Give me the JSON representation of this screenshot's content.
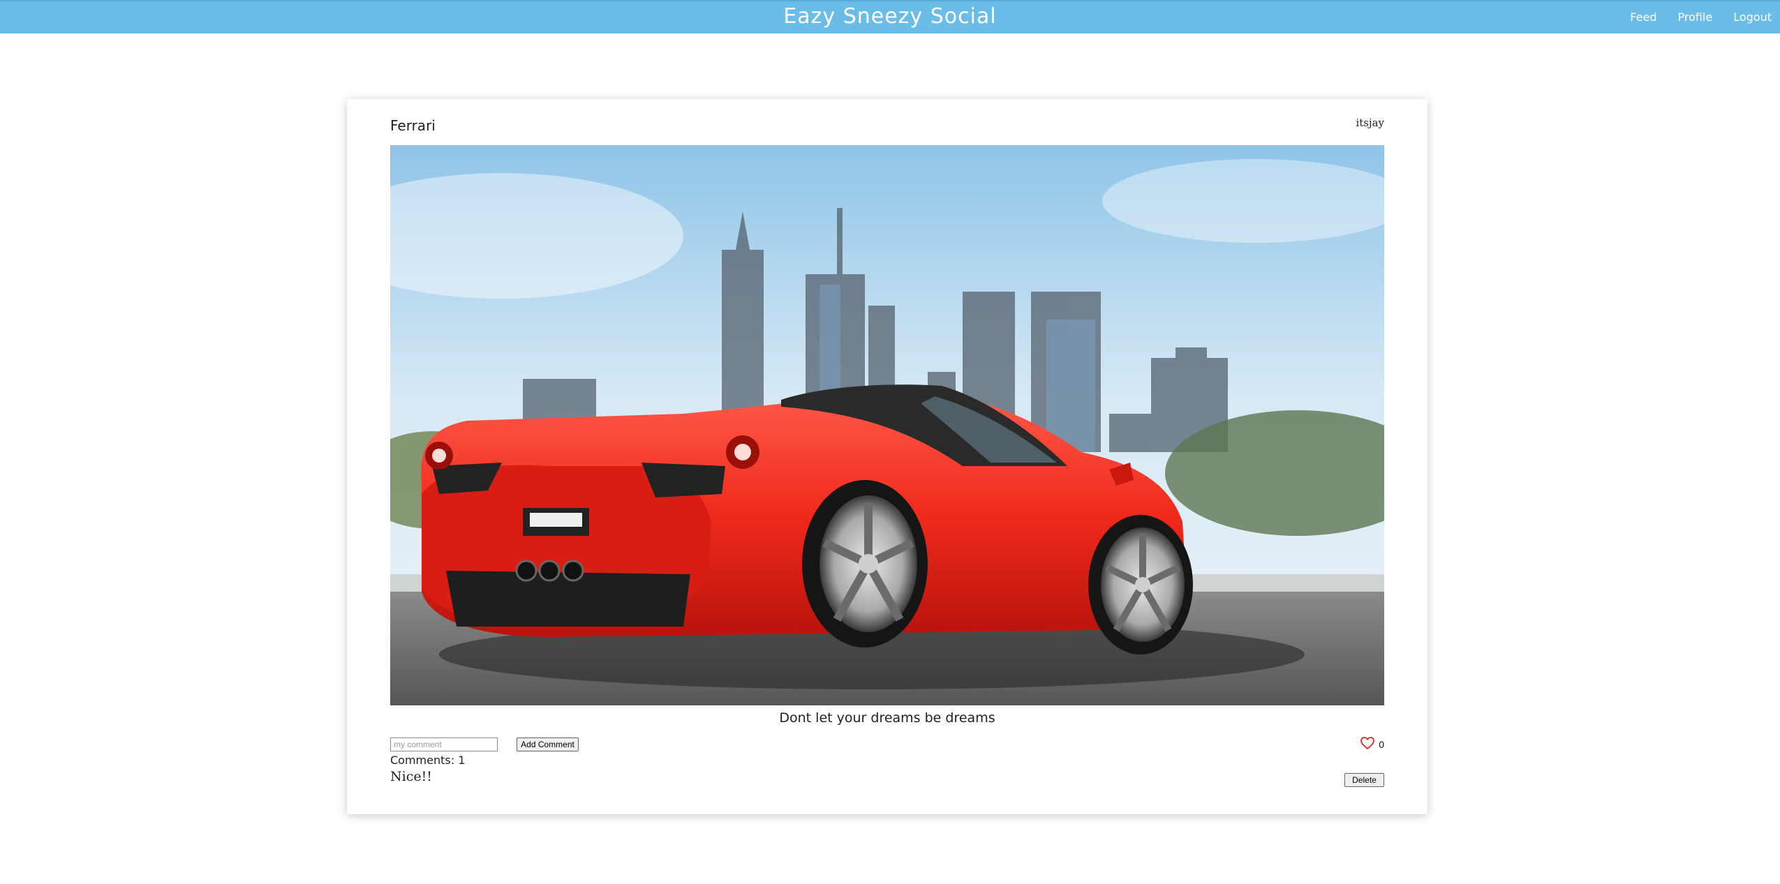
{
  "header": {
    "brand": "Eazy Sneezy Social",
    "nav": [
      {
        "label": "Feed"
      },
      {
        "label": "Profile"
      },
      {
        "label": "Logout"
      }
    ],
    "background_color": "#6bbde8"
  },
  "post": {
    "title": "Ferrari",
    "author": "itsjay",
    "image_subject": "red-sports-car-photo",
    "caption": "Dont let your dreams be dreams",
    "comment_input_placeholder": "my comment",
    "add_comment_label": "Add Comment",
    "comments_count_text": "Comments: 1",
    "comments": [
      {
        "text": "Nice!!"
      }
    ],
    "likes": "0",
    "like_icon": "heart-outline-icon",
    "like_color": "#d62828",
    "delete_label": "Delete"
  }
}
